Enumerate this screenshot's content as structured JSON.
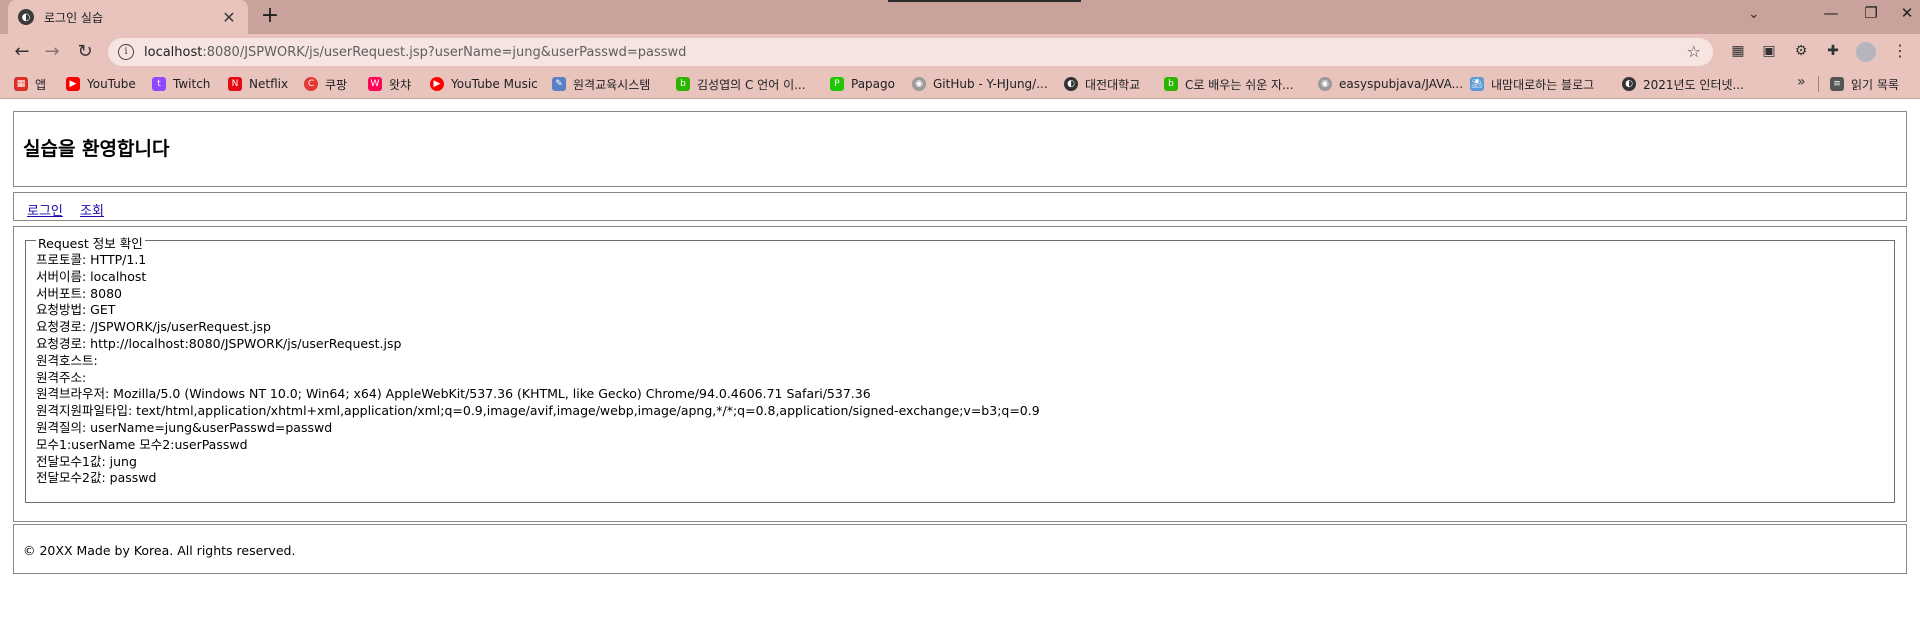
{
  "browser": {
    "tab_title": "로그인 실습",
    "url_host": "localhost",
    "url_rest": ":8080/JSPWORK/js/userRequest.jsp?userName=jung&userPasswd=passwd",
    "bookmarks": [
      {
        "label": "앱",
        "icon": "apps-icon",
        "color": "#d93025"
      },
      {
        "label": "YouTube",
        "icon": "youtube-icon",
        "color": "#ff0000"
      },
      {
        "label": "Twitch",
        "icon": "twitch-icon",
        "color": "#9146ff"
      },
      {
        "label": "Netflix",
        "icon": "netflix-icon",
        "color": "#e50914"
      },
      {
        "label": "쿠팡",
        "icon": "coupang-icon",
        "color": "#e53935"
      },
      {
        "label": "왓챠",
        "icon": "watcha-icon",
        "color": "#ff0558"
      },
      {
        "label": "YouTube Music",
        "icon": "youtube-music-icon",
        "color": "#ff0000"
      },
      {
        "label": "원격교육시스템",
        "icon": "edit-icon",
        "color": "#5b7fc7"
      },
      {
        "label": "김성엽의 C 언어 이...",
        "icon": "blog-icon",
        "color": "#2db400"
      },
      {
        "label": "Papago",
        "icon": "papago-icon",
        "color": "#1ec800"
      },
      {
        "label": "GitHub - Y-HJung/...",
        "icon": "github-icon",
        "color": "#333333"
      },
      {
        "label": "대전대학교",
        "icon": "globe-icon",
        "color": "#333333"
      },
      {
        "label": "C로 배우는 쉬운 자...",
        "icon": "blog-icon",
        "color": "#2db400"
      },
      {
        "label": "easyspubjava/JAVA...",
        "icon": "github-icon",
        "color": "#333333"
      },
      {
        "label": "내맘대로하는 블로그",
        "icon": "tistory-icon",
        "color": "#5b9bd5"
      },
      {
        "label": "2021년도 인터넷...",
        "icon": "globe-icon",
        "color": "#333333"
      }
    ],
    "reading_list": "읽기 목록"
  },
  "page": {
    "title": "실습을 환영합니다",
    "nav_login": "로그인",
    "nav_view": "조회",
    "legend": "Request 정보 확인",
    "lines": [
      "프로토콜: HTTP/1.1",
      "서버이름: localhost",
      "서버포트: 8080",
      "요청방법: GET",
      "요청경로: /JSPWORK/js/userRequest.jsp",
      "요청경로: http://localhost:8080/JSPWORK/js/userRequest.jsp",
      "원격호스트: ",
      "원격주소: ",
      "원격브라우저: Mozilla/5.0 (Windows NT 10.0; Win64; x64) AppleWebKit/537.36 (KHTML, like Gecko) Chrome/94.0.4606.71 Safari/537.36",
      "원격지원파일타입: text/html,application/xhtml+xml,application/xml;q=0.9,image/avif,image/webp,image/apng,*/*;q=0.8,application/signed-exchange;v=b3;q=0.9",
      "원격질의: userName=jung&userPasswd=passwd",
      "모수1:userName 모수2:userPasswd",
      "전달모수1값: jung",
      "전달모수2값: passwd"
    ],
    "footer": "© 20XX Made by Korea. All rights reserved."
  }
}
